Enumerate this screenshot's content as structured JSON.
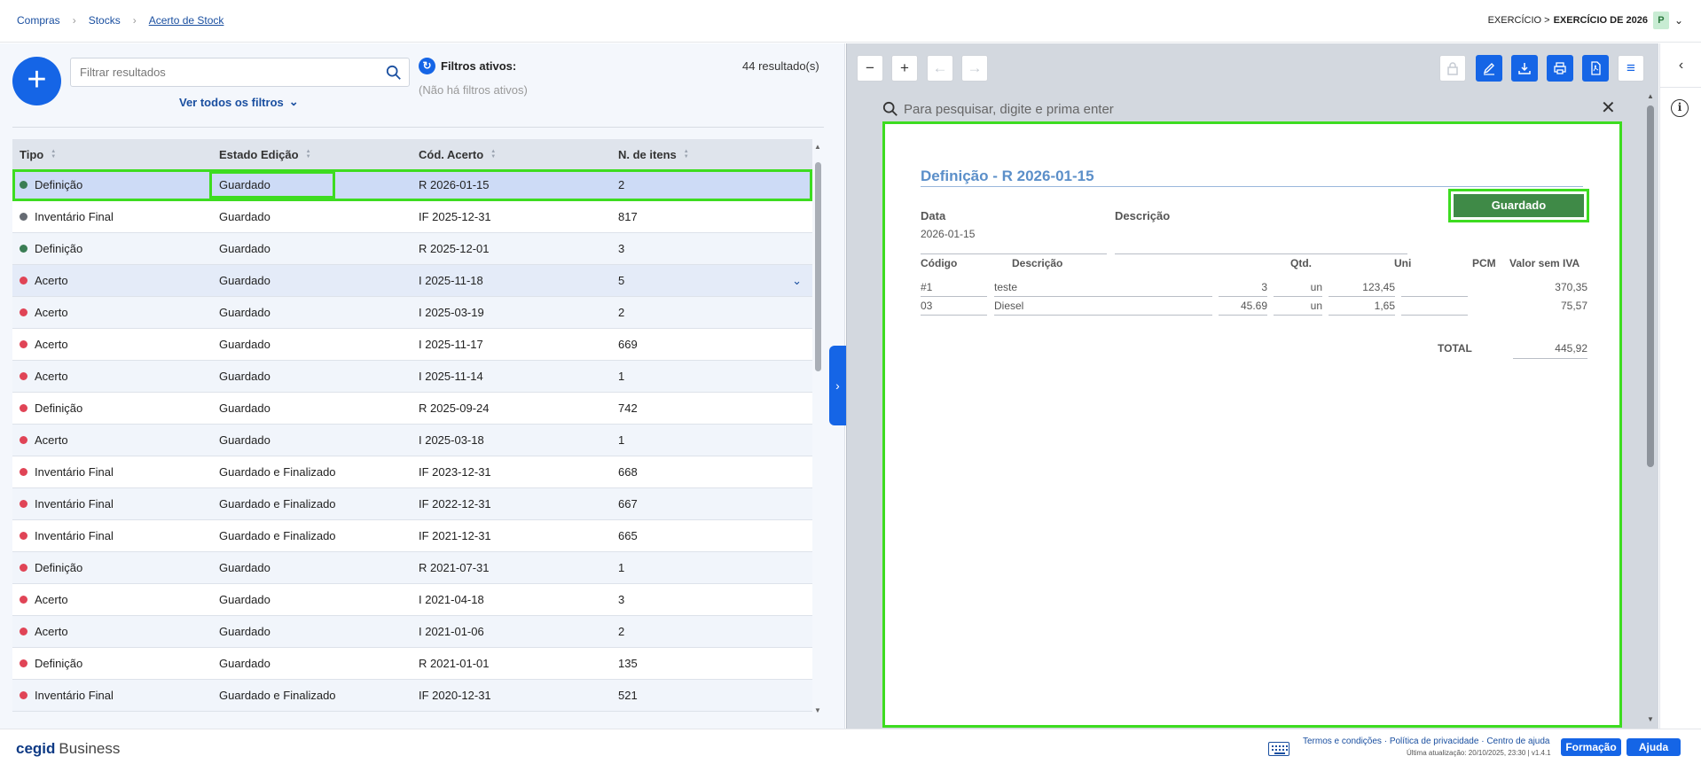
{
  "breadcrumb": {
    "items": [
      "Compras",
      "Stocks"
    ],
    "current": "Acerto de Stock"
  },
  "exercise": {
    "prefix": "EXERCÍCIO >",
    "value": "EXERCÍCIO DE 2026",
    "badge": "P"
  },
  "search": {
    "placeholder": "Filtrar resultados"
  },
  "see_all_filters": "Ver todos os filtros",
  "filters": {
    "title": "Filtros ativos:",
    "none": "(Não há filtros ativos)"
  },
  "results_count": "44 resultado(s)",
  "table": {
    "headers": [
      "Tipo",
      "Estado Edição",
      "Cód. Acerto",
      "N. de itens"
    ],
    "rows": [
      {
        "tipo": "Definição",
        "dot": "#3a7d54",
        "estado": "Guardado",
        "cod": "R 2026-01-15",
        "n": "2"
      },
      {
        "tipo": "Inventário Final",
        "dot": "#666b73",
        "estado": "Guardado",
        "cod": "IF 2025-12-31",
        "n": "817"
      },
      {
        "tipo": "Definição",
        "dot": "#3a7d54",
        "estado": "Guardado",
        "cod": "R 2025-12-01",
        "n": "3"
      },
      {
        "tipo": "Acerto",
        "dot": "#e04456",
        "estado": "Guardado",
        "cod": "I 2025-11-18",
        "n": "5"
      },
      {
        "tipo": "Acerto",
        "dot": "#e04456",
        "estado": "Guardado",
        "cod": "I 2025-03-19",
        "n": "2"
      },
      {
        "tipo": "Acerto",
        "dot": "#e04456",
        "estado": "Guardado",
        "cod": "I 2025-11-17",
        "n": "669"
      },
      {
        "tipo": "Acerto",
        "dot": "#e04456",
        "estado": "Guardado",
        "cod": "I 2025-11-14",
        "n": "1"
      },
      {
        "tipo": "Definição",
        "dot": "#e04456",
        "estado": "Guardado",
        "cod": "R 2025-09-24",
        "n": "742"
      },
      {
        "tipo": "Acerto",
        "dot": "#e04456",
        "estado": "Guardado",
        "cod": "I 2025-03-18",
        "n": "1"
      },
      {
        "tipo": "Inventário Final",
        "dot": "#e04456",
        "estado": "Guardado e Finalizado",
        "cod": "IF 2023-12-31",
        "n": "668"
      },
      {
        "tipo": "Inventário Final",
        "dot": "#e04456",
        "estado": "Guardado e Finalizado",
        "cod": "IF 2022-12-31",
        "n": "667"
      },
      {
        "tipo": "Inventário Final",
        "dot": "#e04456",
        "estado": "Guardado e Finalizado",
        "cod": "IF 2021-12-31",
        "n": "665"
      },
      {
        "tipo": "Definição",
        "dot": "#e04456",
        "estado": "Guardado",
        "cod": "R 2021-07-31",
        "n": "1"
      },
      {
        "tipo": "Acerto",
        "dot": "#e04456",
        "estado": "Guardado",
        "cod": "I 2021-04-18",
        "n": "3"
      },
      {
        "tipo": "Acerto",
        "dot": "#e04456",
        "estado": "Guardado",
        "cod": "I 2021-01-06",
        "n": "2"
      },
      {
        "tipo": "Definição",
        "dot": "#e04456",
        "estado": "Guardado",
        "cod": "R 2021-01-01",
        "n": "135"
      },
      {
        "tipo": "Inventário Final",
        "dot": "#e04456",
        "estado": "Guardado e Finalizado",
        "cod": "IF 2020-12-31",
        "n": "521"
      }
    ]
  },
  "viewer": {
    "search_placeholder": "Para pesquisar, digite e prima enter",
    "doc": {
      "title": "Definição - R 2026-01-15",
      "status": "Guardado",
      "data_label": "Data",
      "data_value": "2026-01-15",
      "descricao_label": "Descrição",
      "columns": [
        "Código",
        "Descrição",
        "Qtd.",
        "Uni",
        "PCM",
        "Valor sem IVA"
      ],
      "lines": [
        {
          "codigo": "#1",
          "descricao": "teste",
          "qtd": "3",
          "uni": "un",
          "pcm": "123,45",
          "valor": "370,35"
        },
        {
          "codigo": "03",
          "descricao": "Diesel",
          "qtd": "45.69",
          "uni": "un",
          "pcm": "1,65",
          "valor": "75,57"
        }
      ],
      "total_label": "TOTAL",
      "total_value": "445,92"
    }
  },
  "footer": {
    "brand": "cegid",
    "product": "Business",
    "links": "Termos e condições · Política de privacidade · Centro de ajuda",
    "updated": "Última atualização: 20/10/2025, 23:30 | v1.4.1",
    "formacao": "Formação",
    "ajuda": "Ajuda"
  },
  "colors": {
    "accent": "#1565e6",
    "highlight": "#3ddc20",
    "status_green": "#3f8a47"
  }
}
